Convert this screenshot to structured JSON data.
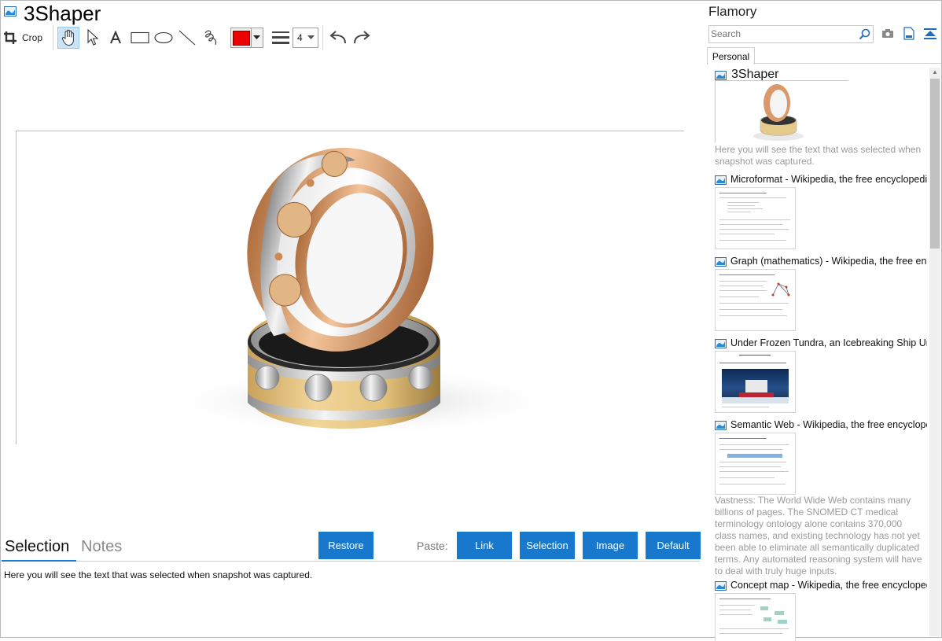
{
  "app": {
    "title": "3Shaper"
  },
  "toolbar": {
    "crop_label": "Crop",
    "line_width_value": "4"
  },
  "colors": {
    "accent": "#1778cc",
    "pen_color": "#ee0000",
    "hand_active_bg": "#cce4f7"
  },
  "bottom": {
    "tabs": [
      "Selection",
      "Notes"
    ],
    "restore_label": "Restore",
    "paste_label": "Paste:",
    "paste_buttons": [
      "Link",
      "Selection",
      "Image",
      "Default"
    ],
    "selection_text": "Here you will see the text that was selected when snapshot was captured."
  },
  "sidebar": {
    "title": "Flamory",
    "search_placeholder": "Search",
    "tab": "Personal",
    "snapshots": [
      {
        "title": "3Shaper",
        "desc": "Here you will see the text that was selected when snapshot was captured."
      },
      {
        "title": "Microformat - Wikipedia, the free encyclopedia"
      },
      {
        "title": "Graph (mathematics) - Wikipedia, the free encyclopedia"
      },
      {
        "title": "Under Frozen Tundra, an Icebreaking Ship Uncovers..."
      },
      {
        "title": "Semantic Web - Wikipedia, the free encyclopedia",
        "desc": "Vastness: The World Wide Web contains many billions of pages. The SNOMED CT medical terminology ontology alone contains 370,000 class names, and existing technology has not yet been able to eliminate all semantically duplicated terms. Any automated reasoning system will have to deal with truly huge inputs."
      },
      {
        "title": "Concept map - Wikipedia, the free encyclopedia"
      }
    ]
  }
}
